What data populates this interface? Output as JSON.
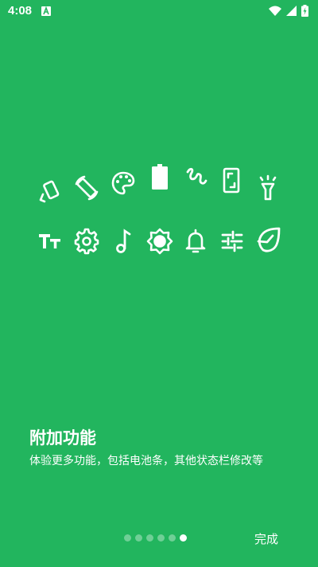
{
  "status_bar": {
    "time": "4:08",
    "notification_icon": "a-letter-icon",
    "system_icons": [
      "wifi-icon",
      "signal-icon",
      "battery-charging-icon"
    ]
  },
  "feature_icons": {
    "row1": [
      "rotate-phone-icon",
      "auto-rotate-icon",
      "palette-icon",
      "battery-icon",
      "squiggle-gesture-icon",
      "screen-icon",
      "flashlight-icon"
    ],
    "row2": [
      "font-size-icon",
      "settings-gear-icon",
      "music-note-icon",
      "brightness-icon",
      "bell-icon",
      "equalizer-icon",
      "fresh-leaf-icon"
    ]
  },
  "onboarding": {
    "title": "附加功能",
    "description": "体验更多功能，包括电池条，其他状态栏修改等"
  },
  "pager": {
    "total": 6,
    "active_index": 6
  },
  "footer": {
    "done_label": "完成"
  },
  "colors": {
    "background": "#22B55E",
    "foreground": "#FFFFFF"
  }
}
